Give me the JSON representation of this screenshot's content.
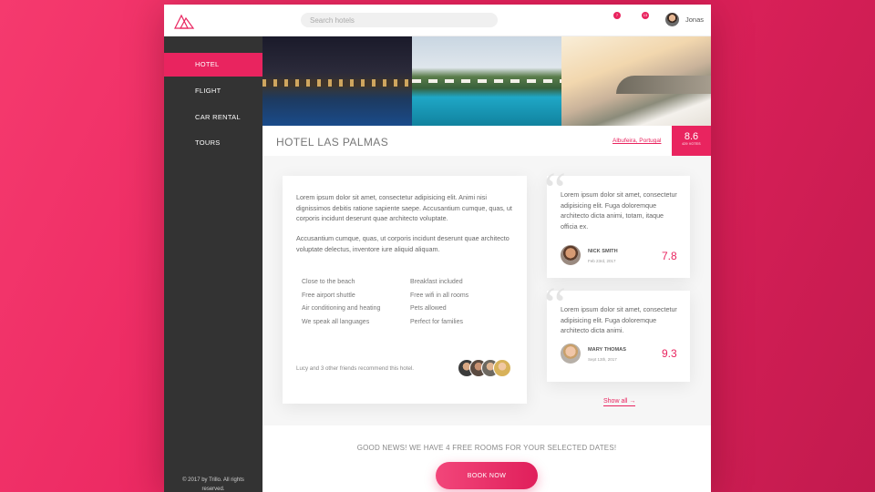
{
  "header": {
    "search_placeholder": "Search hotels",
    "notifications": [
      {
        "icon": "bookmark-icon",
        "count": "7"
      },
      {
        "icon": "chat-icon",
        "count": "13"
      }
    ],
    "user_name": "Jonas"
  },
  "sidebar": {
    "items": [
      {
        "label": "Hotel",
        "active": true
      },
      {
        "label": "Flight",
        "active": false
      },
      {
        "label": "Car rental",
        "active": false
      },
      {
        "label": "Tours",
        "active": false
      }
    ],
    "copyright": "© 2017 by Trillo. All rights reserved."
  },
  "hotel": {
    "name": "Hotel Las Palmas",
    "location": "Albufeira, Portugal",
    "rating": "8.6",
    "votes": "429 votes"
  },
  "description": {
    "paragraph1": "Lorem ipsum dolor sit amet, consectetur adipisicing elit. Animi nisi dignissimos debitis ratione sapiente saepe. Accusantium cumque, quas, ut corporis incidunt deserunt quae architecto voluptate.",
    "paragraph2": "Accusantium cumque, quas, ut corporis incidunt deserunt quae architecto voluptate delectus, inventore iure aliquid aliquam.",
    "features": [
      "Close to the beach",
      "Breakfast included",
      "Free airport shuttle",
      "Free wifi in all rooms",
      "Air conditioning and heating",
      "Pets allowed",
      "We speak all languages",
      "Perfect for families"
    ],
    "recommend_text": "Lucy and 3 other friends recommend this hotel."
  },
  "reviews": [
    {
      "text": "Lorem ipsum dolor sit amet, consectetur adipisicing elit. Fuga doloremque architecto dicta animi, totam, itaque officia ex.",
      "name": "Nick Smith",
      "date": "Feb 23rd, 2017",
      "score": "7.8"
    },
    {
      "text": "Lorem ipsum dolor sit amet, consectetur adipisicing elit. Fuga doloremque architecto dicta animi.",
      "name": "Mary Thomas",
      "date": "Sept 13th, 2017",
      "score": "9.3"
    }
  ],
  "show_all": "Show all →",
  "cta": {
    "text": "Good news! We have 4 free rooms for your selected dates!",
    "button": "Book now"
  },
  "colors": {
    "accent": "#e9245f",
    "sidebar": "#333333",
    "background_gradient": [
      "#f53a6e",
      "#c21a4e"
    ]
  }
}
